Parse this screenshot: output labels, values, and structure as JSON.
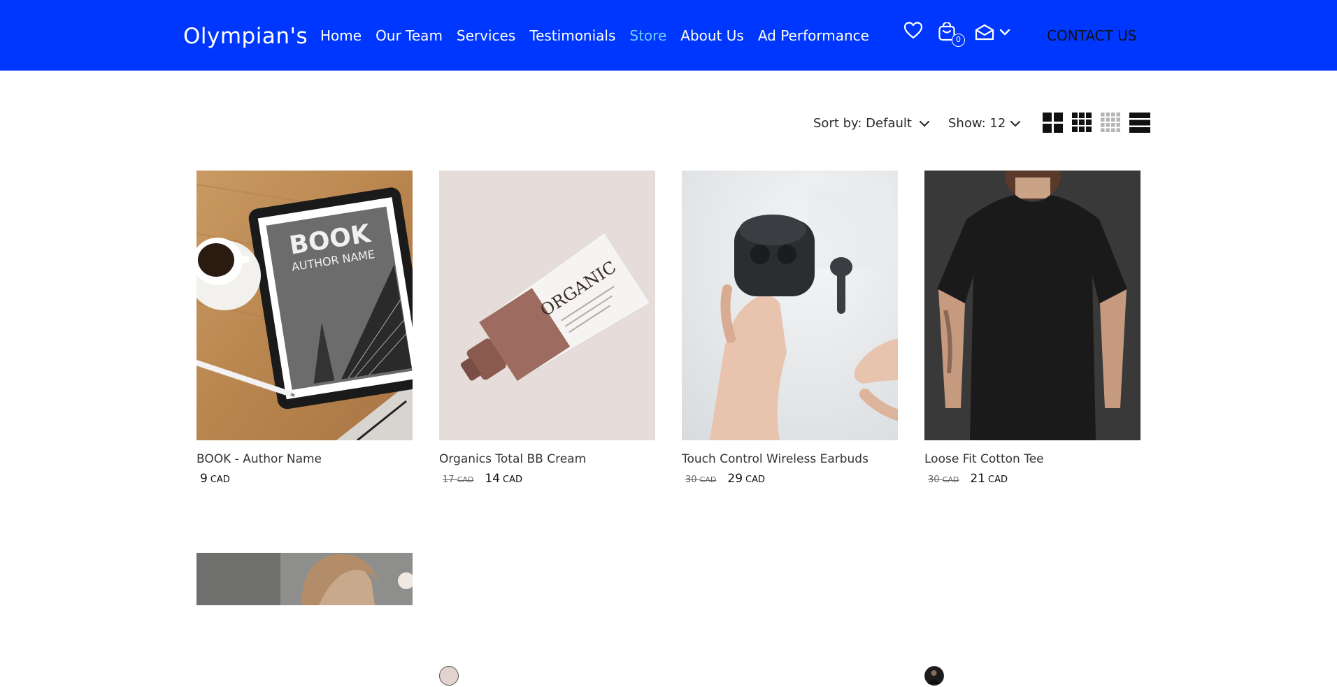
{
  "header": {
    "brand": "Olympian's",
    "nav": [
      {
        "label": "Home",
        "active": false
      },
      {
        "label": "Our Team",
        "active": false
      },
      {
        "label": "Services",
        "active": false
      },
      {
        "label": "Testimonials",
        "active": false
      },
      {
        "label": "Store",
        "active": true
      },
      {
        "label": "About Us",
        "active": false
      },
      {
        "label": "Ad Performance",
        "active": false
      }
    ],
    "icons": [
      "heart-icon",
      "cart-icon",
      "mail-icon",
      "chevron-down-icon"
    ],
    "cart_count": "0",
    "contact_label": "CONTACT US",
    "bg_color": "#0037ff",
    "active_color": "#6fd0ff"
  },
  "toolbar": {
    "sort_label": "Sort by: Default",
    "show_label": "Show: 12",
    "view_modes": [
      "grid-2-icon",
      "grid-3-icon",
      "grid-4-icon",
      "list-icon"
    ]
  },
  "products": [
    {
      "name": "BOOK - Author Name",
      "old_price": "",
      "old_currency": "",
      "price": "9",
      "currency": "CAD",
      "swatch": "",
      "image_text": [
        "BOOK",
        "AUTHOR NAME"
      ]
    },
    {
      "name": "Organics Total BB Cream",
      "old_price": "17",
      "old_currency": "CAD",
      "price": "14",
      "currency": "CAD",
      "swatch": "#e3d3cf",
      "image_text": [
        "ORGANIC"
      ]
    },
    {
      "name": "Touch Control Wireless Earbuds",
      "old_price": "30",
      "old_currency": "CAD",
      "price": "29",
      "currency": "CAD",
      "swatch": ""
    },
    {
      "name": "Loose Fit Cotton Tee",
      "old_price": "30",
      "old_currency": "CAD",
      "price": "21",
      "currency": "CAD",
      "swatch": "#1c1c1c"
    }
  ]
}
